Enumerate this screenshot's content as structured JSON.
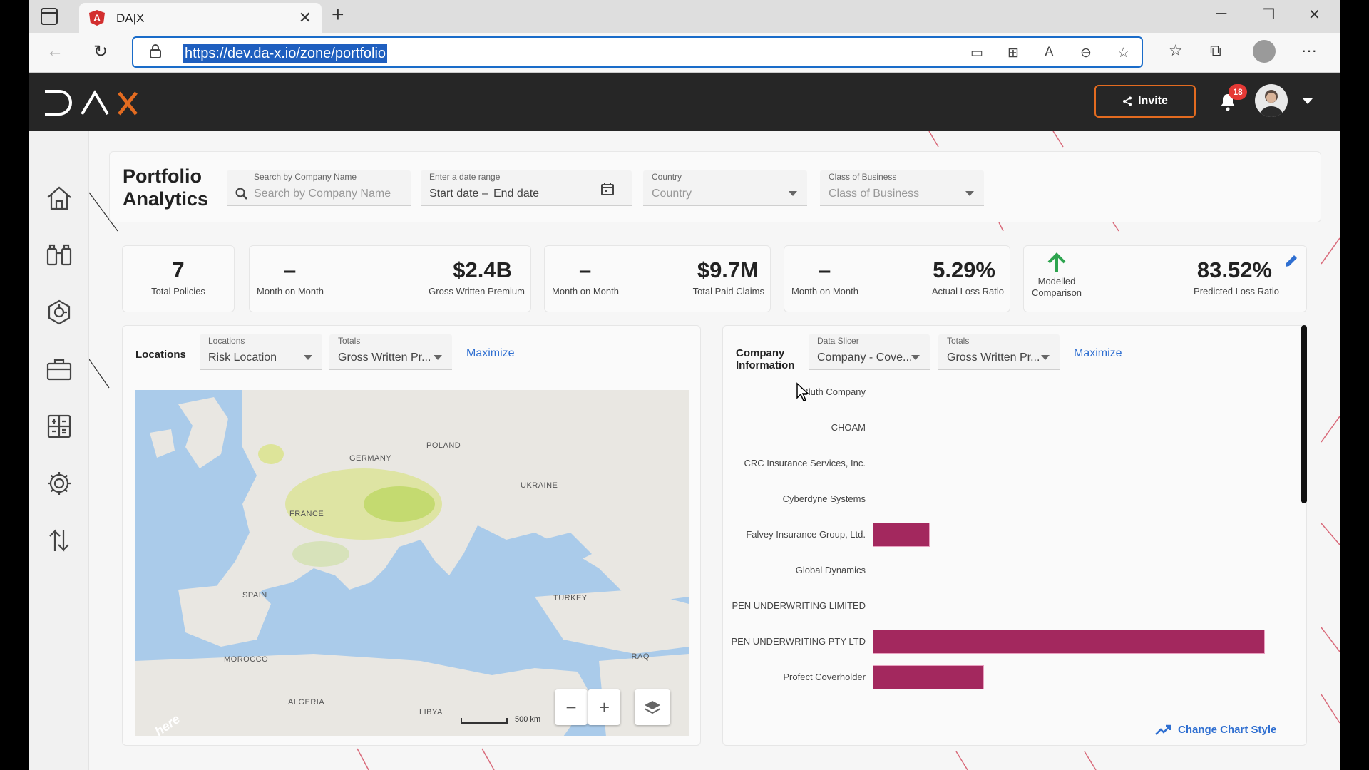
{
  "browser": {
    "tab_title": "DA|X",
    "url": "https://dev.da-x.io/zone/portfolio"
  },
  "header": {
    "logo_letters": [
      "D",
      "Λ",
      "X"
    ],
    "invite_label": "Invite",
    "notification_count": "18"
  },
  "filters": {
    "page_title": "Portfolio Analytics",
    "company_search": {
      "label": "Search by Company Name",
      "placeholder": "Search by Company Name"
    },
    "date_range": {
      "label": "Enter a date range",
      "start_placeholder": "Start date",
      "separator": "–",
      "end_placeholder": "End date"
    },
    "country": {
      "label": "Country",
      "placeholder": "Country"
    },
    "class_of_business": {
      "label": "Class of Business",
      "placeholder": "Class of Business"
    }
  },
  "kpis": {
    "total_policies": {
      "value": "7",
      "label": "Total Policies"
    },
    "gwp": {
      "mom_value": "–",
      "mom_label": "Month on Month",
      "value": "$2.4B",
      "label": "Gross Written Premium"
    },
    "paid_claims": {
      "mom_value": "–",
      "mom_label": "Month on Month",
      "value": "$9.7M",
      "label": "Total Paid Claims"
    },
    "loss_ratio": {
      "mom_value": "–",
      "mom_label": "Month on Month",
      "value": "5.29%",
      "label": "Actual Loss Ratio"
    },
    "predicted": {
      "comparison_label_1": "Modelled",
      "comparison_label_2": "Comparison",
      "value": "83.52%",
      "label": "Predicted Loss Ratio"
    }
  },
  "locations_panel": {
    "title": "Locations",
    "locations_select": {
      "label": "Locations",
      "value": "Risk Location"
    },
    "totals_select": {
      "label": "Totals",
      "value": "Gross Written Pr..."
    },
    "maximize_label": "Maximize",
    "map_labels": [
      "GERMANY",
      "POLAND",
      "UKRAINE",
      "FRANCE",
      "SPAIN",
      "TURKEY",
      "MOROCCO",
      "ALGERIA",
      "LIBYA",
      "IRAQ"
    ],
    "scale_label": "500 km",
    "here_logo": "here"
  },
  "company_panel": {
    "title_line1": "Company",
    "title_line2": "Information",
    "data_slicer": {
      "label": "Data Slicer",
      "value": "Company - Cove..."
    },
    "totals_select": {
      "label": "Totals",
      "value": "Gross Written Pr..."
    },
    "maximize_label": "Maximize",
    "change_chart_label": "Change Chart Style"
  },
  "chart_data": {
    "type": "bar",
    "orientation": "horizontal",
    "categories": [
      "Bluth Company",
      "CHOAM",
      "CRC Insurance Services, Inc.",
      "Cyberdyne Systems",
      "Falvey Insurance Group, Ltd.",
      "Global Dynamics",
      "PEN UNDERWRITING LIMITED",
      "PEN UNDERWRITING PTY LTD",
      "Profect Coverholder"
    ],
    "values": [
      0,
      0,
      0,
      0,
      0.146,
      0,
      0,
      1.0,
      0.283
    ],
    "value_unit": "fraction of largest bar",
    "colors": {
      "bar": "#a3285e"
    }
  },
  "colors": {
    "accent": "#e36b20",
    "link": "#2f6fd1",
    "header_bg": "#262626"
  }
}
